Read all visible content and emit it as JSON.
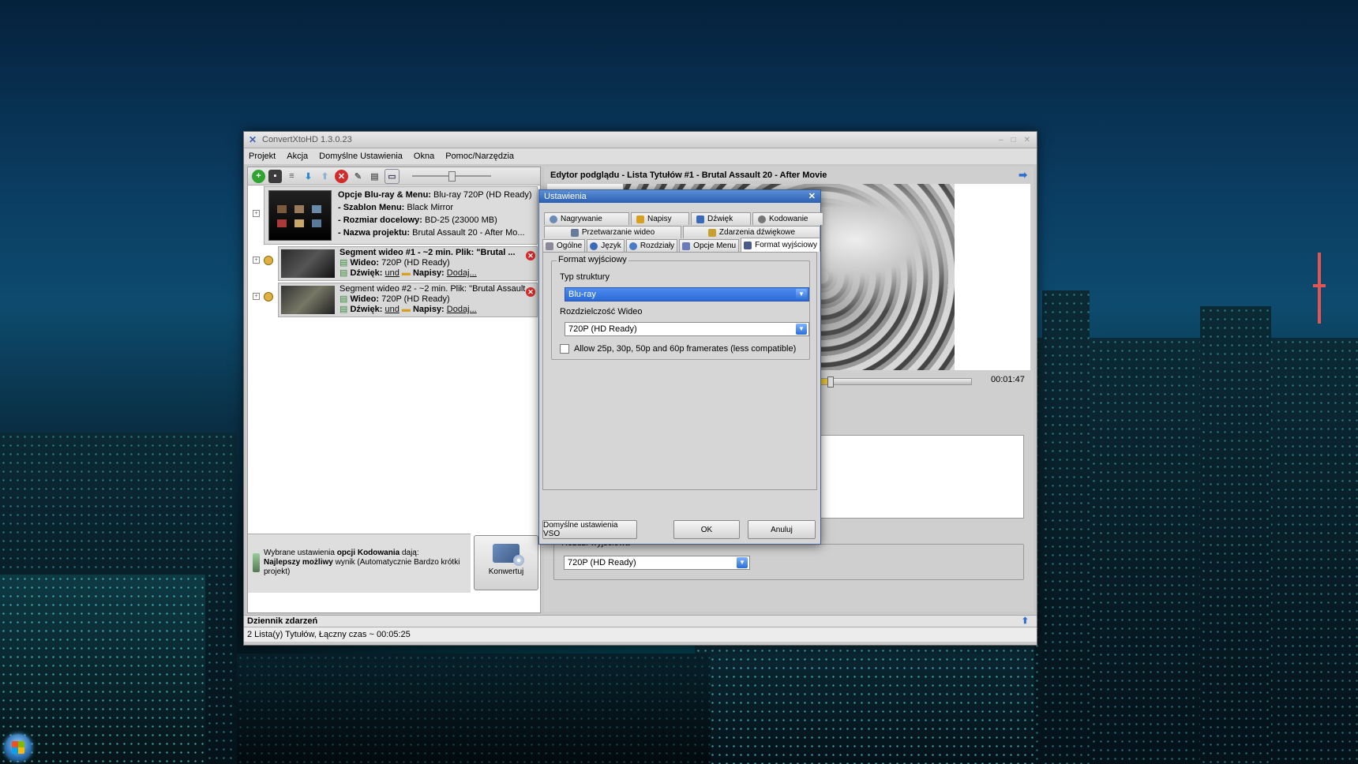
{
  "window": {
    "title": "ConvertXtoHD 1.3.0.23",
    "menu": [
      "Projekt",
      "Akcja",
      "Domyślne Ustawienia",
      "Okna",
      "Pomoc/Narzędzia"
    ]
  },
  "project": {
    "line1_label": "Opcje Blu-ray & Menu:",
    "line1_value": "Blu-ray 720P (HD Ready)",
    "line2_label": "- Szablon Menu:",
    "line2_value": "Black Mirror",
    "line3_label": "- Rozmiar docelowy:",
    "line3_value": "BD-25 (23000 MB)",
    "line4_label": "- Nazwa projektu:",
    "line4_value": "Brutal Assault 20 - After Mo..."
  },
  "segments": [
    {
      "title": "Segment wideo #1 - ~2 min. Plik: \"Brutal ...",
      "video_label": "Wideo:",
      "video_value": "720P (HD Ready)",
      "audio_label": "Dźwięk:",
      "audio_value": "und",
      "subs_label": "Napisy:",
      "subs_value": "Dodaj..."
    },
    {
      "title": "Segment wideo #2 - ~2 min. Plik: \"Brutal Assault...",
      "video_label": "Wideo:",
      "video_value": "720P (HD Ready)",
      "audio_label": "Dźwięk:",
      "audio_value": "und",
      "subs_label": "Napisy:",
      "subs_value": "Dodaj..."
    }
  ],
  "info": {
    "part1": "Wybrane ustawienia ",
    "part2": "opcji Kodowania",
    "part3": " dają:",
    "part4": "Najlepszy możliwy",
    "part5": " wynik (Automatycznie Bardzo krótki projekt)"
  },
  "convert_button": "Konwertuj",
  "preview": {
    "header": "Edytor podglądu - Lista Tytułów #1 - Brutal Assault 20 - After Movie",
    "time": "00:01:47",
    "progress": 0.09,
    "ghost_text": "e"
  },
  "output_res": {
    "legend": "Rozdz. wyjściowa",
    "value": "720P (HD Ready)"
  },
  "log": {
    "title": "Dziennik zdarzeń",
    "summary": "2 Lista(y) Tytułów, Łączny czas ~ 00:05:25"
  },
  "dialog": {
    "title": "Ustawienia",
    "tabs_row1": [
      "Nagrywanie",
      "Napisy",
      "Dźwięk",
      "Kodowanie"
    ],
    "tabs_row2": [
      "Przetwarzanie wideo",
      "Zdarzenia dźwiękowe"
    ],
    "tabs_row3": [
      "Ogólne",
      "Język",
      "Rozdziały",
      "Opcje Menu",
      "Format wyjściowy"
    ],
    "group_legend": "Format wyjściowy",
    "struct_label": "Typ struktury",
    "struct_value": "Blu-ray",
    "res_label": "Rozdzielczość Wideo",
    "res_value": "720P (HD Ready)",
    "checkbox_label": "Allow 25p, 30p, 50p and 60p framerates (less compatible)",
    "checkbox_checked": false,
    "btn_defaults": "Domyślne ustawienia VSO",
    "btn_ok": "OK",
    "btn_cancel": "Anuluj"
  },
  "colors": {
    "accent": "#2b6ad6",
    "danger": "#d32b2b",
    "seek": "#e5c23a"
  }
}
